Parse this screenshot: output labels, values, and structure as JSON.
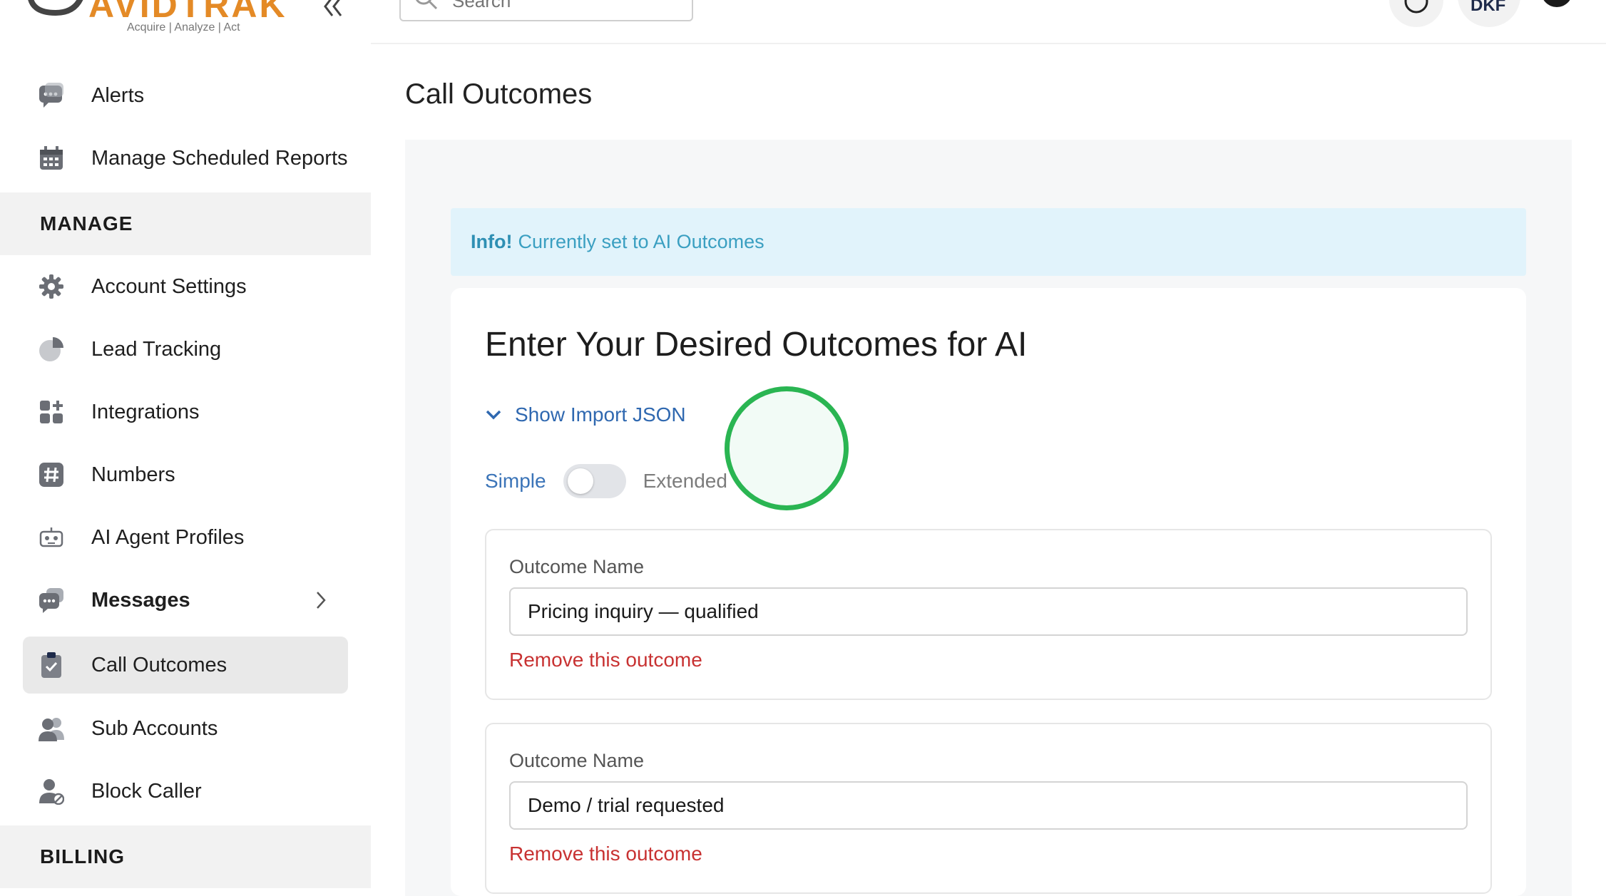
{
  "brand": {
    "logo_text": "AVIDTRAK",
    "tagline": "Acquire  |  Analyze  |  Act"
  },
  "topbar": {
    "search_placeholder": "Search",
    "avatar_initials": "DKF"
  },
  "sidebar": {
    "items_top": [
      {
        "label": "Alerts",
        "icon": "chat-bubble-icon"
      },
      {
        "label": "Manage Scheduled Reports",
        "icon": "calendar-icon"
      }
    ],
    "manage_header": "MANAGE",
    "manage_items": [
      {
        "label": "Account Settings",
        "icon": "gear-icon"
      },
      {
        "label": "Lead Tracking",
        "icon": "pie-chart-icon"
      },
      {
        "label": "Integrations",
        "icon": "apps-grid-icon"
      },
      {
        "label": "Numbers",
        "icon": "hashtag-icon"
      },
      {
        "label": "AI Agent Profiles",
        "icon": "robot-icon"
      },
      {
        "label": "Messages",
        "icon": "messages-icon"
      },
      {
        "label": "Call Outcomes",
        "icon": "clipboard-check-icon"
      },
      {
        "label": "Sub Accounts",
        "icon": "users-icon"
      },
      {
        "label": "Block Caller",
        "icon": "user-block-icon"
      }
    ],
    "billing_header": "BILLING"
  },
  "page": {
    "title": "Call Outcomes",
    "info_label": "Info!",
    "info_text": "Currently set to AI Outcomes",
    "card_title": "Enter Your Desired Outcomes for AI",
    "import_toggle": "Show Import JSON",
    "mode_simple": "Simple",
    "mode_extended": "Extended",
    "mode_selected": "Simple",
    "outcomes": [
      {
        "label": "Outcome Name",
        "value": "Pricing inquiry — qualified",
        "remove": "Remove this outcome"
      },
      {
        "label": "Outcome Name",
        "value": "Demo / trial requested",
        "remove": "Remove this outcome"
      }
    ]
  },
  "colors": {
    "accent": "#2f68b0",
    "info_bg": "#e1f3fb",
    "danger": "#c83232",
    "active_bg": "#e9e9e9",
    "cursor_ring": "#2ab552",
    "brand_orange": "#e48a26"
  }
}
